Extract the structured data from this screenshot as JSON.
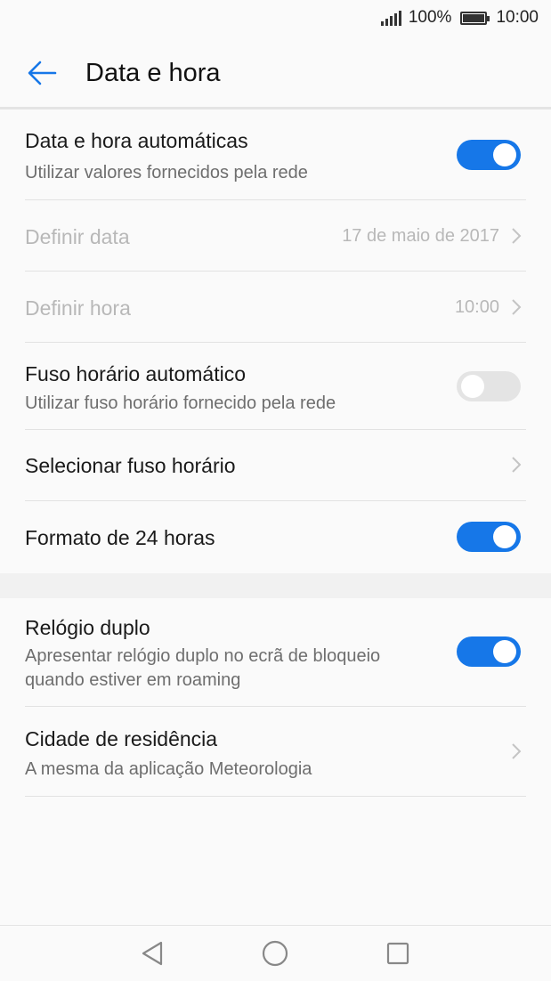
{
  "status_bar": {
    "battery": "100%",
    "time": "10:00",
    "icons": [
      "signal-icon",
      "battery-icon"
    ]
  },
  "header": {
    "title": "Data e hora",
    "back_icon": "back-arrow-icon"
  },
  "settings": {
    "auto_datetime": {
      "title": "Data e hora automáticas",
      "subtitle": "Utilizar valores fornecidos pela rede",
      "toggle": "on"
    },
    "set_date": {
      "title": "Definir data",
      "value": "17 de maio de 2017"
    },
    "set_time": {
      "title": "Definir hora",
      "value": "10:00"
    },
    "auto_timezone": {
      "title": "Fuso horário automático",
      "subtitle": "Utilizar fuso horário fornecido pela rede",
      "toggle": "off"
    },
    "select_timezone": {
      "title": "Selecionar fuso horário"
    },
    "format_24h": {
      "title": "Formato de 24 horas",
      "toggle": "on"
    },
    "dual_clock": {
      "title": "Relógio duplo",
      "subtitle_line1": "Apresentar relógio duplo no ecrã de bloqueio",
      "subtitle_line2": "quando estiver em roaming",
      "toggle": "on"
    },
    "home_city": {
      "title": "Cidade de residência",
      "subtitle": "A mesma da aplicação Meteorologia"
    }
  },
  "nav_bar": {
    "icons": [
      "back-triangle-icon",
      "home-circle-icon",
      "recents-square-icon"
    ]
  },
  "colors": {
    "accent": "#1677e8",
    "toggle_off": "#e4e4e4",
    "disabled_text": "#b8b8b8",
    "secondary_text": "#6e6e6e"
  }
}
